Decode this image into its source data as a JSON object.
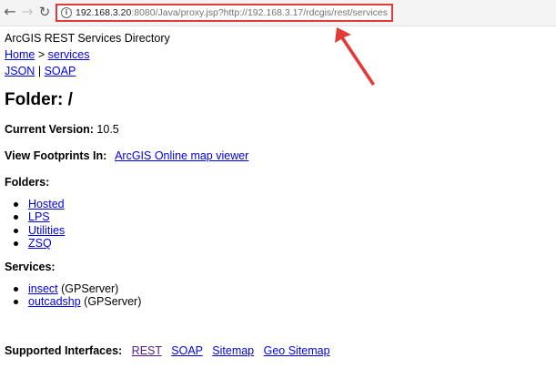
{
  "browser": {
    "url_host": "192.168.3.20",
    "url_rest": ":8080/Java/proxy.jsp?http://192.168.3.17/rdcgis/rest/services",
    "back_icon": "arrow-left-icon",
    "forward_icon": "arrow-right-icon",
    "reload_icon": "reload-icon",
    "info_icon": "info-icon",
    "highlight_color": "#e53935"
  },
  "header": {
    "directory_title": "ArcGIS REST Services Directory",
    "breadcrumb_home": "Home",
    "breadcrumb_sep": ">",
    "breadcrumb_services": "services",
    "format_json": "JSON",
    "format_sep": "|",
    "format_soap": "SOAP"
  },
  "folder": {
    "heading": "Folder: /",
    "current_version_label": "Current Version:",
    "current_version_value": "10.5",
    "footprints_label": "View Footprints In:",
    "footprints_link": "ArcGIS Online map viewer",
    "folders_label": "Folders:",
    "folders": [
      "Hosted",
      "LPS",
      "Utilities",
      "ZSQ"
    ],
    "services_label": "Services:",
    "services": [
      {
        "name": "insect",
        "type": "(GPServer)"
      },
      {
        "name": "outcadshp",
        "type": "(GPServer)"
      }
    ],
    "interfaces_label": "Supported Interfaces:",
    "interfaces": [
      "REST",
      "SOAP",
      "Sitemap",
      "Geo Sitemap"
    ]
  }
}
